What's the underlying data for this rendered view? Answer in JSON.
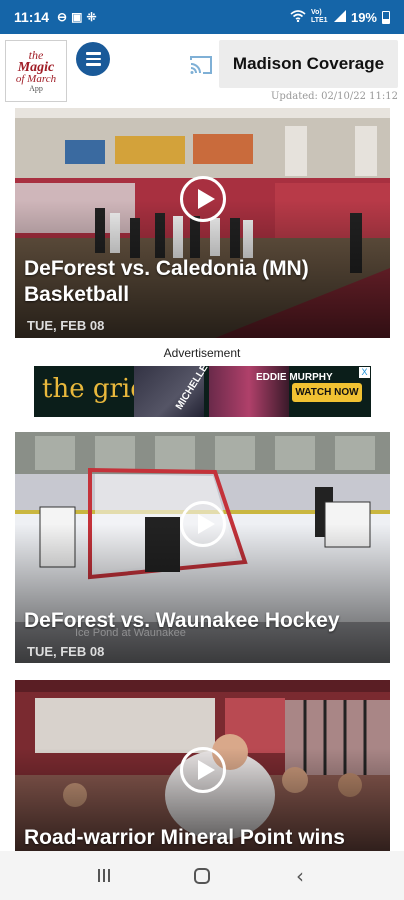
{
  "status_bar": {
    "time": "11:14",
    "battery": "19%",
    "network": "Vo) LTE1",
    "icons": [
      "do-not-disturb-icon",
      "screenshot-icon",
      "grid-icon",
      "wifi-icon",
      "signal-icon",
      "battery-icon"
    ]
  },
  "header": {
    "logo": {
      "line1": "the",
      "line2": "Magic",
      "line3": "of March",
      "line4": "App"
    },
    "coverage_button": "Madison Coverage",
    "updated": "Updated: 02/10/22 11:12"
  },
  "videos": [
    {
      "title": "DeForest vs. Caledonia (MN) Basketball",
      "date": "TUE, FEB 08",
      "thumb_colors": [
        "#b9b2a6",
        "#a83040",
        "#3a3530"
      ]
    },
    {
      "title": "DeForest vs. Waunakee Hockey",
      "date": "TUE, FEB 08",
      "watermark": "Ice Pond at Waunakee",
      "thumb_colors": [
        "#e8e8ec",
        "#c7c8d0",
        "#3a3a40"
      ]
    },
    {
      "title": "Road-warrior Mineral Point wins",
      "thumb_colors": [
        "#7a2a30",
        "#d8d2cc",
        "#5a2a2a"
      ]
    }
  ],
  "ad": {
    "label": "Advertisement",
    "brand": "the grio",
    "name1": "MICHELLE OBAMA",
    "name2": "EDDIE MURPHY",
    "cta": "WATCH NOW",
    "close": "X"
  },
  "colors": {
    "status_bar": "#1565a8",
    "menu_button": "#1a5a99",
    "logo_red": "#a01d26",
    "ad_cta": "#f1c232"
  }
}
